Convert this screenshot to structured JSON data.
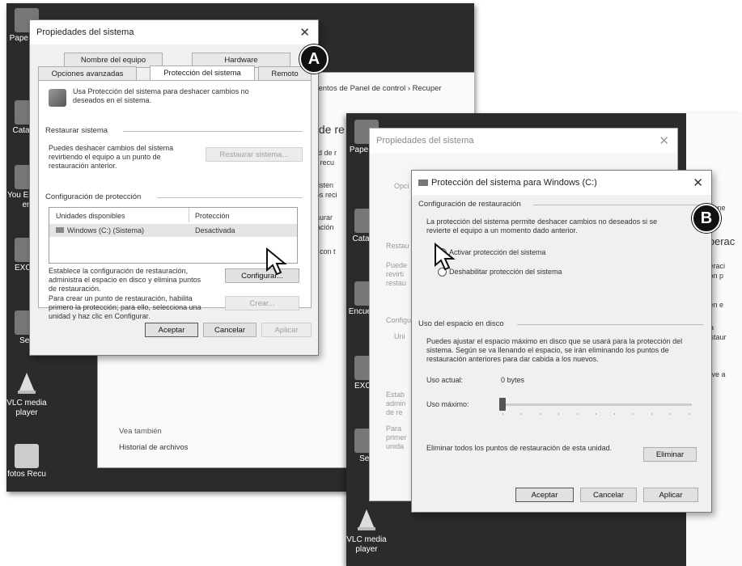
{
  "badges": {
    "a": "A",
    "b": "B"
  },
  "shot_a": {
    "desktop_icons": [
      "Pape recı",
      "Cata Or",
      "You Encue en",
      "EXC P",
      "Seg",
      "VLC media player",
      "fotos Recu"
    ],
    "bg_window": {
      "breadcrumb": "dementos de Panel de control  ›  Recuper",
      "heading": "s de re",
      "lines": [
        "dad de r",
        "de recu",
        "r sisten",
        "bios reci",
        "staurar",
        "uración"
      ],
      "extra": "as con t",
      "see_also": "Vea también",
      "history_link": "Historial de archivos"
    },
    "dialog": {
      "title": "Propiedades del sistema",
      "tabs_row1": [
        "Nombre del equipo",
        "Hardware"
      ],
      "tabs_row2": [
        "Opciones avanzadas",
        "Protección del sistema",
        "Remoto"
      ],
      "intro": "Usa Protección del sistema para deshacer cambios no deseados en el sistema.",
      "restore_header": "Restaurar sistema",
      "restore_text": "Puedes deshacer cambios del sistema revirtiendo el equipo a un punto de restauración anterior.",
      "restore_button": "Restaurar sistema...",
      "config_header": "Configuración de protección",
      "table_headers": [
        "Unidades disponibles",
        "Protección"
      ],
      "table_row": {
        "drive": "Windows (C:) (Sistema)",
        "status": "Desactivada"
      },
      "configure_text": "Establece la configuración de restauración, administra el espacio en disco y elimina puntos de restauración.",
      "configure_button": "Configurar...",
      "create_text": "Para crear un punto de restauración, habilita primero la protección; para ello, selecciona una unidad y haz clic en Configurar.",
      "create_button": "Crear...",
      "ok": "Aceptar",
      "cancel": "Cancelar",
      "apply": "Aplicar"
    }
  },
  "shot_b": {
    "desktop_icons": [
      "Pape reci",
      "Cata Or",
      "Encue enl",
      "EXC P",
      "Seg",
      "VLC media player"
    ],
    "bg_dialog": {
      "title": "Propiedades del sistema",
      "tab": "Opci",
      "left_labels": [
        "Restau",
        "Puede revirti restau",
        "Configu",
        "Uni",
        "Estab admin de re",
        "Para primer unida"
      ]
    },
    "bg_right": {
      "lines": [
        "e Pane",
        "cuperac",
        "cuperaci",
        "ración p",
        "tes en e",
        "tema",
        "e restaur",
        "PC, ve a"
      ]
    },
    "dialog": {
      "title": "Protección del sistema para Windows (C:)",
      "restore_settings_header": "Configuración de restauración",
      "restore_settings_text": "La protección del sistema permite deshacer cambios no deseados si se revierte el equipo a un momento dado anterior.",
      "option_on": "Activar protección del sistema",
      "option_off": "Deshabilitar protección del sistema",
      "disk_header": "Uso del espacio en disco",
      "disk_text": "Puedes ajustar el espacio máximo en disco que se usará para la protección del sistema. Según se va llenando el espacio, se irán eliminando los puntos de restauración anteriores para dar cabida a los nuevos.",
      "current_usage_label": "Uso actual:",
      "current_usage_value": "0 bytes",
      "max_usage_label": "Uso máximo:",
      "max_usage_fraction": 0.0,
      "delete_text": "Eliminar todos los puntos de restauración de esta unidad.",
      "delete_button": "Eliminar",
      "ok": "Aceptar",
      "cancel": "Cancelar",
      "apply": "Aplicar"
    }
  }
}
